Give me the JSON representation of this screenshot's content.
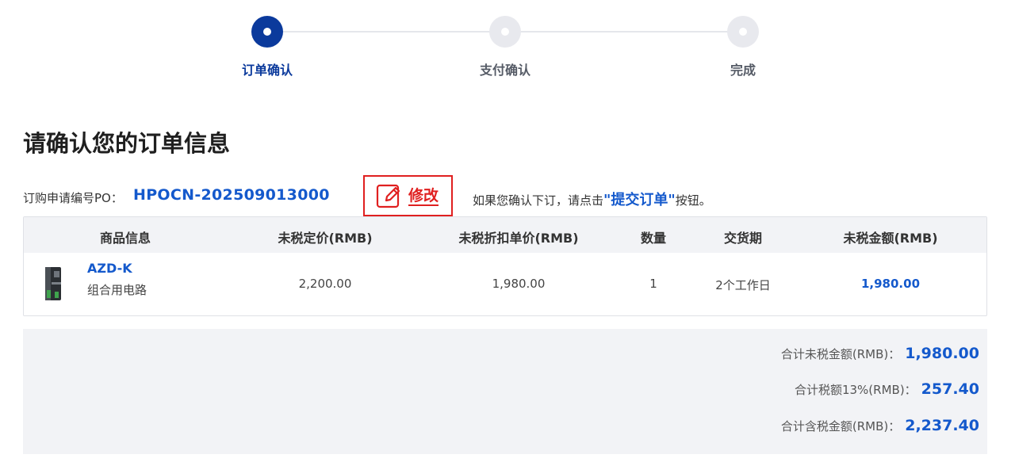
{
  "steps": [
    {
      "label": "订单确认",
      "state": "active"
    },
    {
      "label": "支付确认",
      "state": "pending"
    },
    {
      "label": "完成",
      "state": "pending"
    }
  ],
  "page_title": "请确认您的订单信息",
  "po": {
    "label": "订购申请编号PO：",
    "number": "HPOCN-202509013000"
  },
  "edit": {
    "label": "修改",
    "icon": "pencil-edit-icon"
  },
  "notice": {
    "prefix": "如果您确认下订，请点击",
    "highlight": "\"提交订单\"",
    "suffix": "按钮。"
  },
  "table": {
    "headers": [
      "商品信息",
      "未税定价(RMB)",
      "未税折扣单价(RMB)",
      "数量",
      "交货期",
      "未税金额(RMB)"
    ],
    "rows": [
      {
        "name": "AZD-K",
        "desc": "组合用电路",
        "list_price": "2,200.00",
        "unit_price": "1,980.00",
        "qty": "1",
        "delivery": "2个工作日",
        "amount": "1,980.00"
      }
    ]
  },
  "summary": {
    "subtotal_label": "合计未税金额(RMB)：",
    "subtotal_value": "1,980.00",
    "tax_label": "合计税额13%(RMB)：",
    "tax_value": "257.40",
    "total_label": "合计含税金额(RMB)：",
    "total_value": "2,237.40"
  },
  "colors": {
    "accent": "#0b3a9c",
    "link": "#1459cc",
    "edit_red": "#e02020",
    "panel_bg": "#f2f3f6"
  }
}
